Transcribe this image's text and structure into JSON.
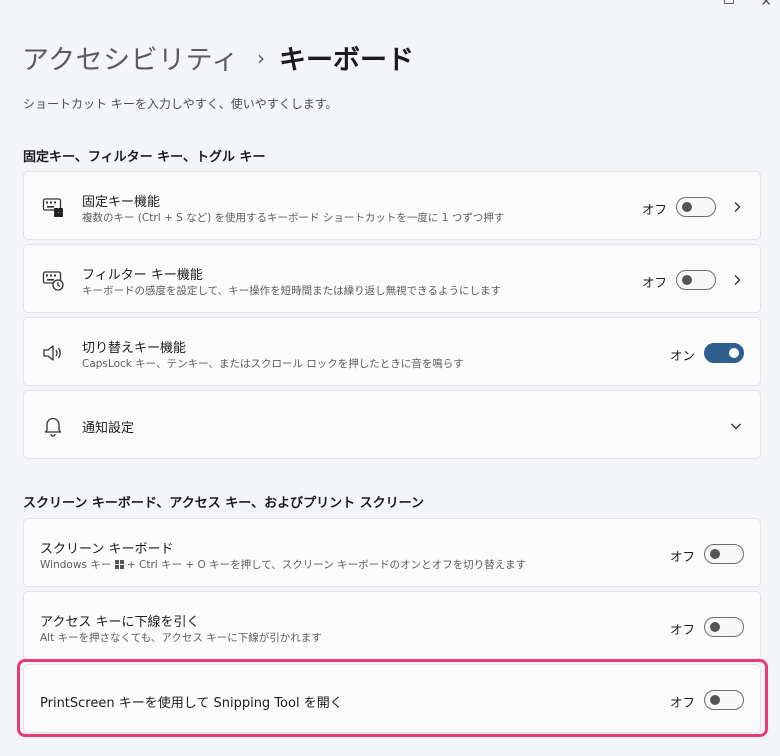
{
  "breadcrumb": {
    "parent": "アクセシビリティ",
    "separator": "›",
    "current": "キーボード"
  },
  "subtitle": "ショートカット キーを入力しやすく、使いやすくします。",
  "section1": {
    "heading": "固定キー、フィルター キー、トグル キー",
    "sticky": {
      "title": "固定キー機能",
      "desc": "複数のキー (Ctrl + S など) を使用するキーボード ショートカットを一度に 1 つずつ押す",
      "state": "オフ",
      "on": false,
      "icon": "sticky-keys-icon"
    },
    "filter": {
      "title": "フィルター キー機能",
      "desc": "キーボードの感度を設定して、キー操作を短時間または繰り返し無視できるようにします",
      "state": "オフ",
      "on": false,
      "icon": "filter-keys-icon"
    },
    "toggle": {
      "title": "切り替えキー機能",
      "desc": "CapsLock キー、テンキー、またはスクロール ロックを押したときに音を鳴らす",
      "state": "オン",
      "on": true,
      "icon": "speaker-icon"
    },
    "notify": {
      "title": "通知設定",
      "icon": "bell-icon"
    }
  },
  "section2": {
    "heading": "スクリーン キーボード、アクセス キー、およびプリント スクリーン",
    "osk": {
      "title": "スクリーン キーボード",
      "desc_before": "Windows キー ",
      "desc_after": " + Ctrl キー + O キーを押して、スクリーン キーボードのオンとオフを切り替えます",
      "state": "オフ",
      "on": false
    },
    "access": {
      "title": "アクセス キーに下線を引く",
      "desc": "Alt キーを押さなくても、アクセス キーに下線が引かれます",
      "state": "オフ",
      "on": false
    },
    "printscreen": {
      "title": "PrintScreen キーを使用して Snipping Tool を開く",
      "state": "オフ",
      "on": false
    }
  },
  "colors": {
    "accent": "#2f5f8f",
    "highlight": "#ec3b73",
    "background": "#f3f5f9"
  }
}
